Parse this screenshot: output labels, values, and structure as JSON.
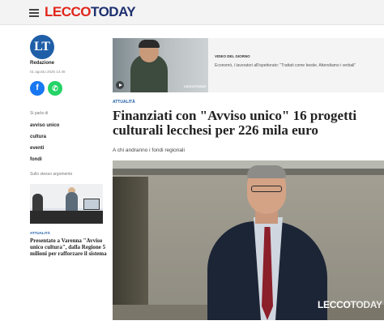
{
  "header": {
    "logo_part1": "LECCO",
    "logo_part2": "TODAY"
  },
  "sidebar": {
    "avatar_initials": "LT",
    "author": "Redazione",
    "date": "01 agosto 2025 14:46",
    "share_facebook": "f",
    "share_whatsapp": "✆",
    "topics_label": "Si parla di",
    "tags": [
      "avviso unico",
      "cultura",
      "eventi",
      "fondi"
    ],
    "related_label": "Sullo stesso argomento",
    "related": {
      "category": "ATTUALITÀ",
      "title": "Presentato a Varenna \"Avviso unico cultura\", dalla Regione 5 milioni per rafforzare il sistema"
    }
  },
  "video": {
    "kicker": "VIDEO DEL GIORNO",
    "text": "Economò, i lavoratori all'ispettorato: \"Trattati come bestie. Attendiamo i verbali\"",
    "brand": "LECCOTODAY"
  },
  "article": {
    "category": "ATTUALITÀ",
    "headline": "Finanziati con \"Avviso unico\" 16 progetti culturali lecchesi per 226 mila euro",
    "summary": "A chi andranno i fondi regionali",
    "watermark_part1": "LECCO",
    "watermark_part2": "TODAY"
  },
  "colors": {
    "brand_red": "#e1251b",
    "brand_blue": "#1d2f6f",
    "category_blue": "#1f5fa8",
    "facebook": "#1877f2",
    "whatsapp": "#25d366"
  },
  "icons": [
    "menu-icon",
    "facebook-icon",
    "whatsapp-icon",
    "play-icon"
  ]
}
